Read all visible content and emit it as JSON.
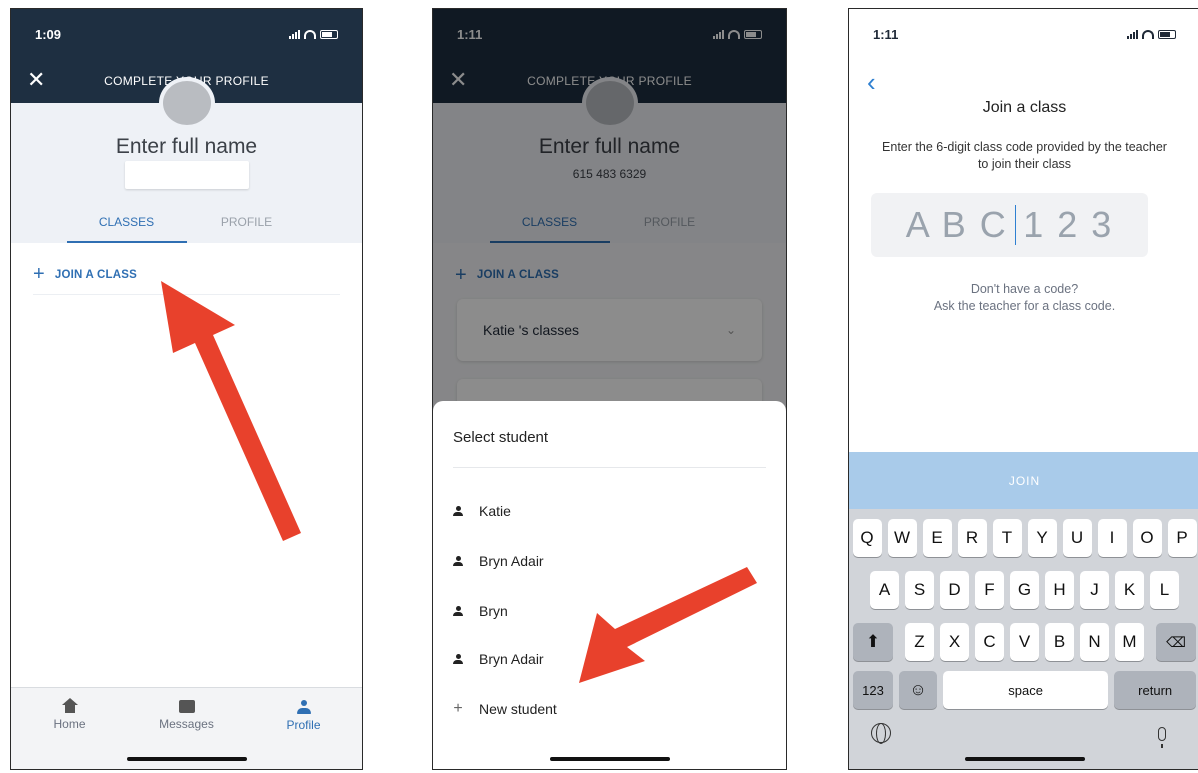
{
  "screen1": {
    "time": "1:09",
    "header_title": "COMPLETE YOUR PROFILE",
    "name_placeholder": "Enter full name",
    "tabs": [
      "CLASSES",
      "PROFILE"
    ],
    "join_label": "JOIN A CLASS",
    "nav": [
      "Home",
      "Messages",
      "Profile"
    ]
  },
  "screen2": {
    "time": "1:11",
    "header_title": "COMPLETE YOUR PROFILE",
    "name_placeholder": "Enter full name",
    "phone": "615 483 6329",
    "tabs": [
      "CLASSES",
      "PROFILE"
    ],
    "join_label": "JOIN A CLASS",
    "class_card": "Katie 's classes",
    "sheet_title": "Select student",
    "students": [
      "Katie",
      "Bryn Adair",
      "Bryn",
      "Bryn Adair"
    ],
    "new_student": "New student"
  },
  "screen3": {
    "time": "1:11",
    "title": "Join a class",
    "description": "Enter the 6-digit class code provided by the teacher to join their class",
    "code_before": "A B C",
    "code_after": "1 2 3",
    "hint_line1": "Don't have a code?",
    "hint_line2": "Ask the teacher for a class code.",
    "join_button": "JOIN",
    "keys_row1": [
      "Q",
      "W",
      "E",
      "R",
      "T",
      "Y",
      "U",
      "I",
      "O",
      "P"
    ],
    "keys_row2": [
      "A",
      "S",
      "D",
      "F",
      "G",
      "H",
      "J",
      "K",
      "L"
    ],
    "keys_row3": [
      "Z",
      "X",
      "C",
      "V",
      "B",
      "N",
      "M"
    ],
    "key_123": "123",
    "key_space": "space",
    "key_return": "return"
  },
  "colors": {
    "accent": "#2f6fb3",
    "header": "#1e2f41",
    "arrow": "#e8412c",
    "join_button": "#a9cbea"
  }
}
